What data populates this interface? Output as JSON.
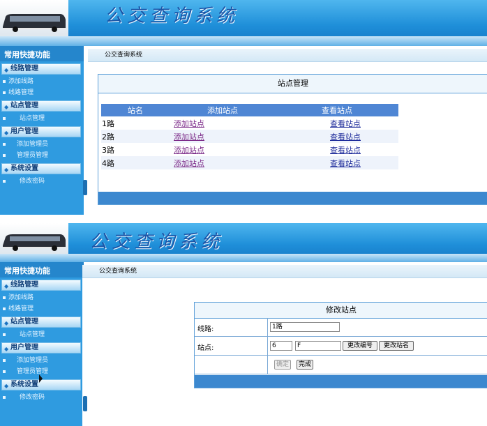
{
  "app": {
    "title": "公交查询系统"
  },
  "sidebar": {
    "header": "常用快捷功能",
    "groups": [
      {
        "title": "线路管理",
        "items": [
          "添加线路",
          "线路管理"
        ]
      },
      {
        "title": "站点管理",
        "items": [
          "站点管理"
        ]
      },
      {
        "title": "用户管理",
        "items": [
          "添加管理员",
          "管理员管理"
        ]
      },
      {
        "title": "系统设置",
        "items": [
          "修改密码"
        ]
      }
    ]
  },
  "breadcrumb": "公交查询系统",
  "station_panel": {
    "title": "站点管理",
    "columns": [
      "站名",
      "添加站点",
      "查看站点"
    ],
    "rows": [
      {
        "name": "1路",
        "add": "添加站点",
        "view": "查看站点"
      },
      {
        "name": "2路",
        "add": "添加站点",
        "view": "查看站点"
      },
      {
        "name": "3路",
        "add": "添加站点",
        "view": "查看站点"
      },
      {
        "name": "4路",
        "add": "添加站点",
        "view": "查看站点"
      }
    ]
  },
  "edit_panel": {
    "title": "修改站点",
    "line_label": "线路:",
    "line_value": "1路",
    "station_label": "站点:",
    "station_no": "6",
    "station_name": "F",
    "btn_change_no": "更改编号",
    "btn_change_name": "更改站名",
    "btn_confirm": "确定",
    "btn_done": "完成"
  },
  "colors": {
    "header": "#1f8fd9",
    "sidebar": "#2f9be0",
    "table_head": "#4f86d4",
    "frame_border": "#5d9fd8"
  }
}
